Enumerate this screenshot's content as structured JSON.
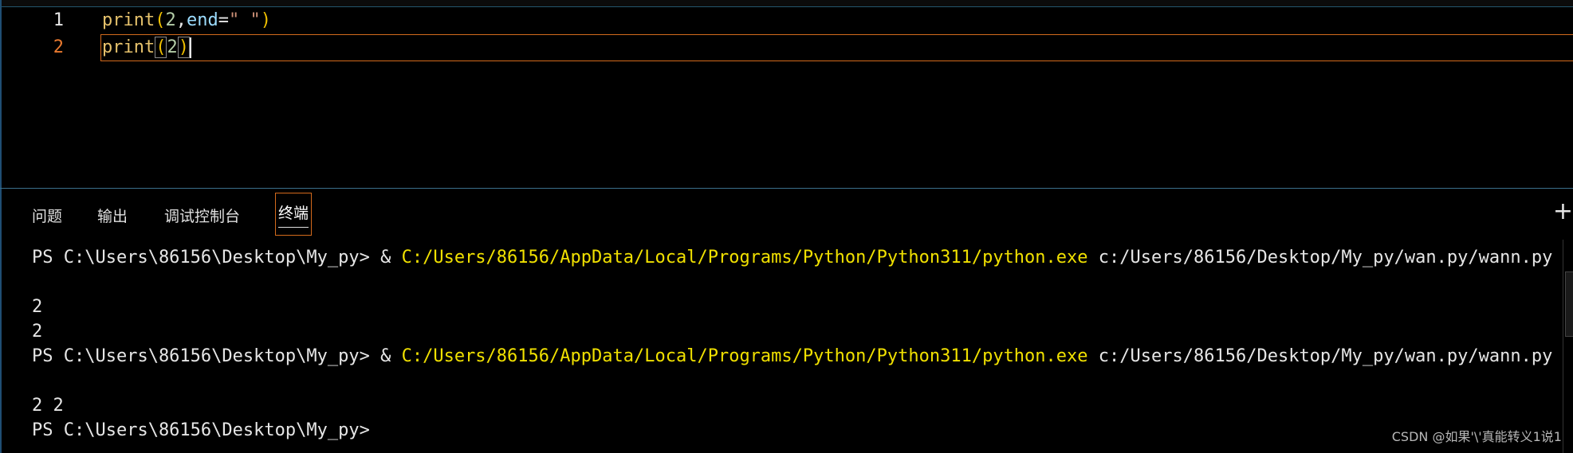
{
  "editor": {
    "lines": [
      {
        "number": "1",
        "tokens": {
          "fn": "print",
          "open": "(",
          "arg": "2",
          "comma": ",",
          "kw": "end",
          "eq": "=",
          "str": "\" \"",
          "close": ")"
        }
      },
      {
        "number": "2",
        "tokens": {
          "fn": "print",
          "open": "(",
          "arg": "2",
          "close": ")"
        }
      }
    ]
  },
  "panel": {
    "tabs": [
      {
        "label": "问题"
      },
      {
        "label": "输出"
      },
      {
        "label": "调试控制台"
      },
      {
        "label": "终端",
        "active": true
      }
    ],
    "plus_label": "+"
  },
  "terminal": {
    "prompt": "PS C:\\Users\\86156\\Desktop\\My_py>",
    "call_operator": "&",
    "python_path": "C:/Users/86156/AppData/Local/Programs/Python/Python311/python.exe",
    "script_path": "c:/Users/86156/Desktop/My_py/wan.py/wann.py",
    "output_run1_line1": "2",
    "output_run1_line2": "2",
    "output_run2_line1": "2 2"
  },
  "watermark": "CSDN @如果'\\'真能转义1说1",
  "colors": {
    "background": "#000000",
    "active_line_border": "#d36a1c",
    "path_highlight": "#f0e000",
    "divider": "#3a6f8c"
  }
}
